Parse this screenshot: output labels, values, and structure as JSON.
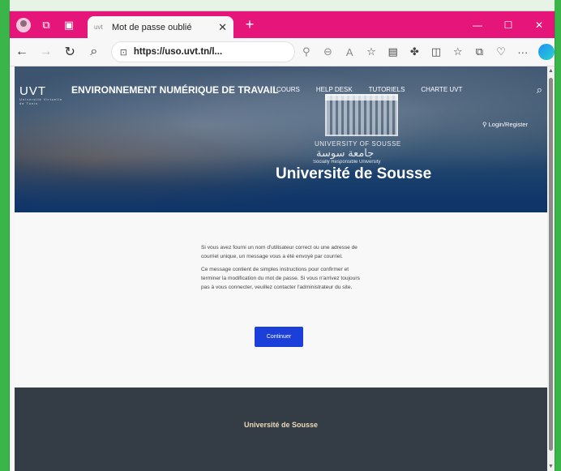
{
  "browser": {
    "tab_title": "Mot de passe oublié",
    "new_tab_glyph": "+",
    "url_host": "https://uso.uvt.tn/l...",
    "window_controls": [
      "minimize-icon",
      "maximize-icon",
      "close-icon"
    ]
  },
  "header": {
    "logo_text": "UVT",
    "logo_subtext": "Université Virtuelle de Tunis",
    "site_title": "ENVIRONNEMENT NUMÉRIQUE DE TRAVAIL",
    "nav": [
      {
        "label": "COURS"
      },
      {
        "label": "HELP DESK"
      },
      {
        "label": "TUTORIELS"
      },
      {
        "label": "CHARTE UVT"
      }
    ],
    "login_label": "Login/Register",
    "university_en": "UNIVERSITY OF SOUSSE",
    "university_ar": "جامعة سوسة",
    "university_tagline": "Socially Responsible University",
    "hero_heading": "Université de Sousse"
  },
  "main": {
    "paragraph_1": "Si vous avez fourni un nom d'utilisateur correct ou une adresse de courriel unique, un message vous a été envoyé par courriel.",
    "paragraph_2": "Ce message contient de simples instructions pour confirmer et terminer la modification du mot de passe. Si vous n'arrivez toujours pas à vous connecter, veuillez contacter l'administrateur du site.",
    "continue_label": "Continuer"
  },
  "footer": {
    "title": "Université de Sousse"
  },
  "colors": {
    "titlebar": "#e6157a",
    "button": "#1b3fd8",
    "footer": "#343d45",
    "footer_text": "#ecd9b8"
  }
}
